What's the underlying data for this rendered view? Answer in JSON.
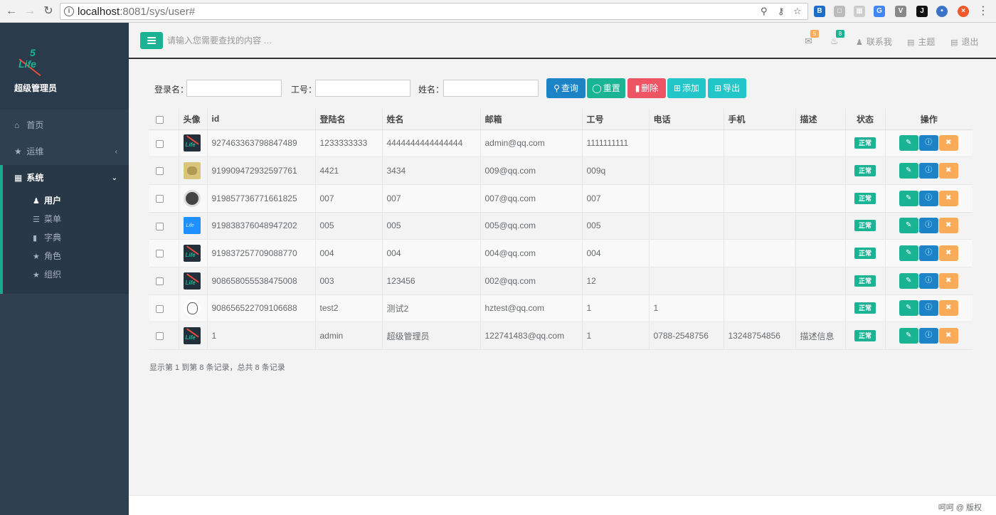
{
  "browser": {
    "url_host": "localhost",
    "url_rest": ":8081/sys/user#"
  },
  "sidebar": {
    "role_name": "超级管理员",
    "logo_top": "5",
    "logo_bottom": "Life",
    "items": [
      {
        "label": "首页",
        "icon": "home-icon"
      },
      {
        "label": "运维",
        "icon": "star-icon"
      },
      {
        "label": "系统",
        "icon": "grid-icon"
      }
    ],
    "sub_items": [
      {
        "label": "用户",
        "icon": "user-icon"
      },
      {
        "label": "菜单",
        "icon": "list-icon"
      },
      {
        "label": "字典",
        "icon": "book-icon"
      },
      {
        "label": "角色",
        "icon": "star-icon"
      },
      {
        "label": "组织",
        "icon": "star-icon"
      }
    ]
  },
  "header": {
    "search_placeholder": "请输入您需要查找的内容 …",
    "mail_count": "5",
    "bell_count": "8",
    "contact": "联系我",
    "theme": "主题",
    "logout": "退出"
  },
  "filters": {
    "login_label": "登录名：",
    "job_label": "工号：",
    "name_label": "姓名："
  },
  "buttons": {
    "query": "查询",
    "reset": "重置",
    "delete": "删除",
    "add": "添加",
    "export": "导出"
  },
  "table": {
    "columns": [
      "头像",
      "id",
      "登陆名",
      "姓名",
      "邮箱",
      "工号",
      "电话",
      "手机",
      "描述",
      "状态",
      "操作"
    ],
    "rows": [
      {
        "avatar": "logo",
        "id": "927463363798847489",
        "login": "1233333333",
        "name": "4444444444444444",
        "email": "admin@qq.com",
        "job": "1111111111",
        "phone": "",
        "mobile": "",
        "desc": "",
        "status": "正常"
      },
      {
        "avatar": "cat",
        "id": "919909472932597761",
        "login": "4421",
        "name": "3434",
        "email": "009@qq.com",
        "job": "009q",
        "phone": "",
        "mobile": "",
        "desc": "",
        "status": "正常"
      },
      {
        "avatar": "dark",
        "id": "919857736771661825",
        "login": "007",
        "name": "007",
        "email": "007@qq.com",
        "job": "007",
        "phone": "",
        "mobile": "",
        "desc": "",
        "status": "正常"
      },
      {
        "avatar": "blue",
        "id": "919838376048947202",
        "login": "005",
        "name": "005",
        "email": "005@qq.com",
        "job": "005",
        "phone": "",
        "mobile": "",
        "desc": "",
        "status": "正常"
      },
      {
        "avatar": "logo",
        "id": "919837257709088770",
        "login": "004",
        "name": "004",
        "email": "004@qq.com",
        "job": "004",
        "phone": "",
        "mobile": "",
        "desc": "",
        "status": "正常"
      },
      {
        "avatar": "logo",
        "id": "908658055538475008",
        "login": "003",
        "name": "123456",
        "email": "002@qq.com",
        "job": "12",
        "phone": "",
        "mobile": "",
        "desc": "",
        "status": "正常"
      },
      {
        "avatar": "face",
        "id": "908656522709106688",
        "login": "test2",
        "name": "测试2",
        "email": "hztest@qq.com",
        "job": "1",
        "phone": "1",
        "mobile": "",
        "desc": "",
        "status": "正常"
      },
      {
        "avatar": "logo",
        "id": "1",
        "login": "admin",
        "name": "超级管理员",
        "email": "122741483@qq.com",
        "job": "1",
        "phone": "0788-2548756",
        "mobile": "13248754856",
        "desc": "描述信息",
        "status": "正常"
      }
    ]
  },
  "pagination": {
    "info": "显示第 1 到第 8 条记录，总共 8 条记录"
  },
  "footer": {
    "text": "呵呵 @ 版权"
  },
  "colors": {
    "sidebar_bg": "#2f4050",
    "primary": "#1ab394",
    "info": "#1c84c6",
    "danger": "#ed5565",
    "warning": "#f8ac59",
    "cyan": "#23c6c8"
  }
}
